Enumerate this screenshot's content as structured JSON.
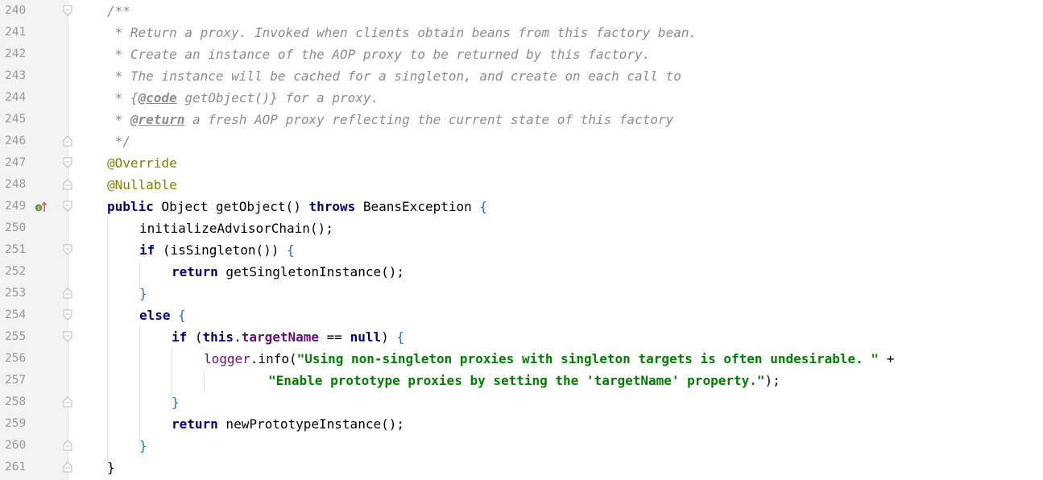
{
  "editor": {
    "lines": [
      {
        "num": "240",
        "fold": "open"
      },
      {
        "num": "241",
        "fold": "none"
      },
      {
        "num": "242",
        "fold": "none"
      },
      {
        "num": "243",
        "fold": "none"
      },
      {
        "num": "244",
        "fold": "none"
      },
      {
        "num": "245",
        "fold": "none"
      },
      {
        "num": "246",
        "fold": "close"
      },
      {
        "num": "247",
        "fold": "open"
      },
      {
        "num": "248",
        "fold": "close"
      },
      {
        "num": "249",
        "fold": "open"
      },
      {
        "num": "250",
        "fold": "none"
      },
      {
        "num": "251",
        "fold": "open"
      },
      {
        "num": "252",
        "fold": "none"
      },
      {
        "num": "253",
        "fold": "close"
      },
      {
        "num": "254",
        "fold": "open"
      },
      {
        "num": "255",
        "fold": "open"
      },
      {
        "num": "256",
        "fold": "none"
      },
      {
        "num": "257",
        "fold": "none"
      },
      {
        "num": "258",
        "fold": "close"
      },
      {
        "num": "259",
        "fold": "none"
      },
      {
        "num": "260",
        "fold": "close"
      },
      {
        "num": "261",
        "fold": "close"
      }
    ],
    "tokens": {
      "l240": "/**",
      "l241": " * Return a proxy. Invoked when clients obtain beans from this factory bean.",
      "l242": " * Create an instance of the AOP proxy to be returned by this factory.",
      "l243": " * The instance will be cached for a singleton, and create on each call to",
      "l244_a": " * {",
      "l244_tag": "@code",
      "l244_b": " getObject()} for a proxy.",
      "l245_a": " * ",
      "l245_tag": "@return",
      "l245_b": " a fresh AOP proxy reflecting the current state of this factory",
      "l246": " */",
      "l247": "@Override",
      "l248": "@Nullable",
      "l249_kw1": "public",
      "l249_a": " Object getObject() ",
      "l249_kw2": "throws",
      "l249_b": " BeansException ",
      "l249_br": "{",
      "l250": "initializeAdvisorChain();",
      "l251_kw": "if",
      "l251_a": " (isSingleton()) ",
      "l251_br": "{",
      "l252_kw": "return",
      "l252_a": " getSingletonInstance();",
      "l253_br": "}",
      "l254_kw": "else",
      "l254_br": " {",
      "l255_kw": "if",
      "l255_a": " (",
      "l255_this": "this",
      "l255_dot": ".",
      "l255_fld": "targetName",
      "l255_b": " == ",
      "l255_null": "null",
      "l255_c": ") ",
      "l255_br": "{",
      "l256_fld": "logger",
      "l256_a": ".info(",
      "l256_str": "\"Using non-singleton proxies with singleton targets is often undesirable. \"",
      "l256_b": " +",
      "l257_str": "\"Enable prototype proxies by setting the 'targetName' property.\"",
      "l257_a": ");",
      "l258_br": "}",
      "l259_kw": "return",
      "l259_a": " newPrototypeInstance();",
      "l260_br": "}",
      "l261_br": "}"
    },
    "gutter_marker": "implementation-up-icon"
  }
}
